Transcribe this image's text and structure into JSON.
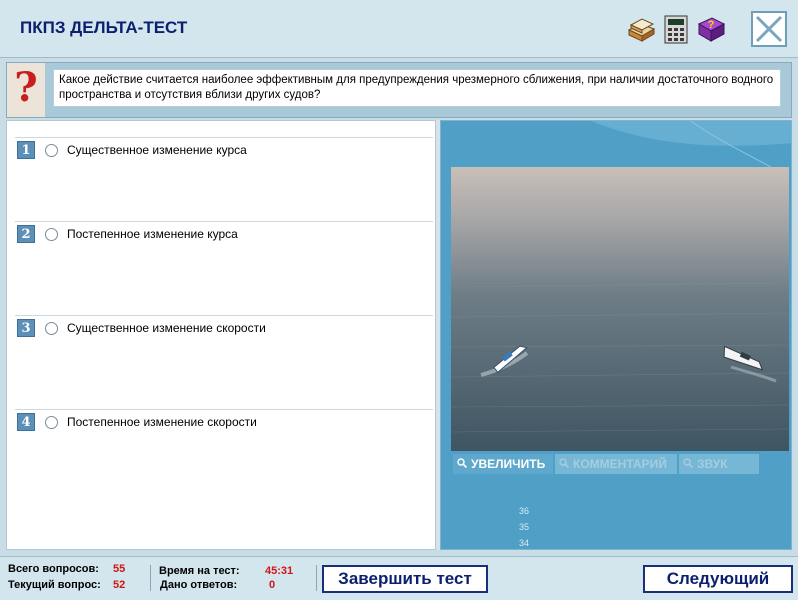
{
  "app": {
    "title": "ПКПЗ ДЕЛЬТА-ТЕСТ"
  },
  "toolbar": {
    "icons": [
      "books-icon",
      "calculator-icon",
      "help-book-icon",
      "close-icon"
    ]
  },
  "question": {
    "text": "Какое действие считается наиболее эффективным для предупреждения чрезмерного сближения, при наличии достаточного водного пространства и отсутствия вблизи других судов?"
  },
  "answers": [
    {
      "num": "1",
      "label": "Существенное изменение курса"
    },
    {
      "num": "2",
      "label": "Постепенное изменение курса"
    },
    {
      "num": "3",
      "label": "Существенное изменение скорости"
    },
    {
      "num": "4",
      "label": "Постепенное изменение скорости"
    }
  ],
  "media": {
    "zoom_label": "УВЕЛИЧИТЬ",
    "comments_label": "КОММЕНТАРИЙ",
    "sound_label": "ЗВУК",
    "scale_marks": [
      "36",
      "35",
      "34"
    ]
  },
  "footer": {
    "total_label": "Всего вопросов:",
    "total_value": "55",
    "current_label": "Текущий вопрос:",
    "current_value": "52",
    "time_label": "Время на тест:",
    "time_value": "45:31",
    "answered_label": "Дано ответов:",
    "answered_value": "0",
    "finish_label": "Завершить тест",
    "next_label": "Следующий"
  },
  "colors": {
    "accent": "#0c1f6e",
    "panel": "#4f9fc6",
    "value_red": "#d21414"
  }
}
